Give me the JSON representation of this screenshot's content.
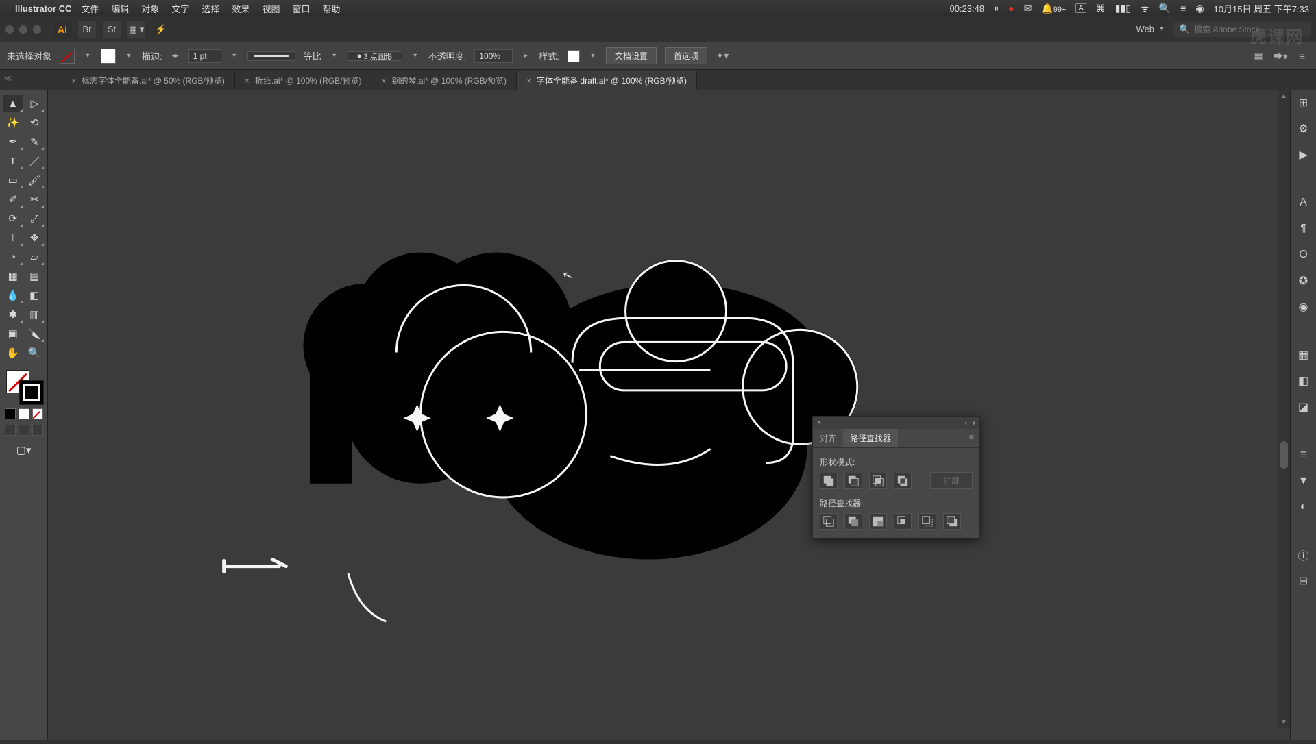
{
  "menubar": {
    "app": "Illustrator CC",
    "items": [
      "文件",
      "编辑",
      "对象",
      "文字",
      "选择",
      "效果",
      "视图",
      "窗口",
      "帮助"
    ],
    "timer": "00:23:48",
    "notif": "99+",
    "ime": "A",
    "date": "10月15日 周五 下午7:33"
  },
  "topbar": {
    "doc_profile": "Web",
    "search_placeholder": "搜索 Adobe Stock"
  },
  "control": {
    "selection": "未选择对象",
    "stroke_label": "描边:",
    "stroke_weight": "1 pt",
    "stroke_variable": "等比",
    "brush": "3 点圆形",
    "opacity_label": "不透明度:",
    "opacity": "100%",
    "style_label": "样式:",
    "doc_setup": "文档设置",
    "prefs": "首选项"
  },
  "tabs": [
    {
      "label": "标志字体全能番.ai* @ 50% (RGB/预览)",
      "active": false
    },
    {
      "label": "折纸.ai* @ 100% (RGB/预览)",
      "active": false
    },
    {
      "label": "钢的琴.ai* @ 100% (RGB/预览)",
      "active": false
    },
    {
      "label": "字体全能番 draft.ai* @ 100% (RGB/预览)",
      "active": true
    }
  ],
  "panel": {
    "tab_align": "对齐",
    "tab_pathfinder": "路径查找器",
    "shape_modes": "形状模式:",
    "pathfinders": "路径查找器:",
    "expand": "扩展"
  },
  "watermark": "虎课网"
}
